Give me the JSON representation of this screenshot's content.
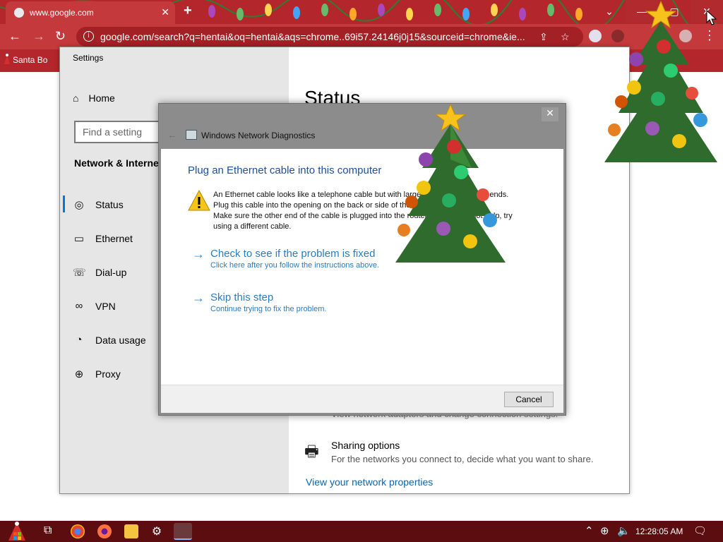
{
  "chrome": {
    "tab_title": "www.google.com",
    "new_tab": "+",
    "url": "google.com/search?q=hentai&oq=hentai&aqs=chrome..69i57.24146j0j15&sourceid=chrome&ie...",
    "bookmark": "Santa Bo"
  },
  "settings": {
    "window_title": "Settings",
    "home": "Home",
    "search_placeholder": "Find a setting",
    "section": "Network & Internet",
    "nav": [
      "Status",
      "Ethernet",
      "Dial-up",
      "VPN",
      "Data usage",
      "Proxy"
    ],
    "status_heading": "Status",
    "hidden_text": "View network adapters and change connection settings.",
    "sharing_title": "Sharing options",
    "sharing_desc": "For the networks you connect to, decide what you want to share.",
    "network_props": "View your network properties"
  },
  "dialog": {
    "title": "Windows Network Diagnostics",
    "heading": "Plug an Ethernet cable into this computer",
    "message_lines": [
      "An Ethernet cable looks like a telephone cable but with larger connectors on the ends.",
      "Plug this cable into the opening on the back or side of the computer.",
      "Make sure the other end of the cable is plugged into the router. If that does not help, try",
      "using a different cable."
    ],
    "option1_title": "Check to see if the problem is fixed",
    "option1_sub": "Click here after you follow the instructions above.",
    "option2_title": "Skip this step",
    "option2_sub": "Continue trying to fix the problem.",
    "cancel": "Cancel"
  },
  "taskbar": {
    "clock": "12:28:05 AM"
  },
  "colors": {
    "chrome_red": "#c4393c",
    "taskbar": "#5b0d10",
    "link_blue": "#2b7bc1",
    "accent": "#0078d7"
  }
}
